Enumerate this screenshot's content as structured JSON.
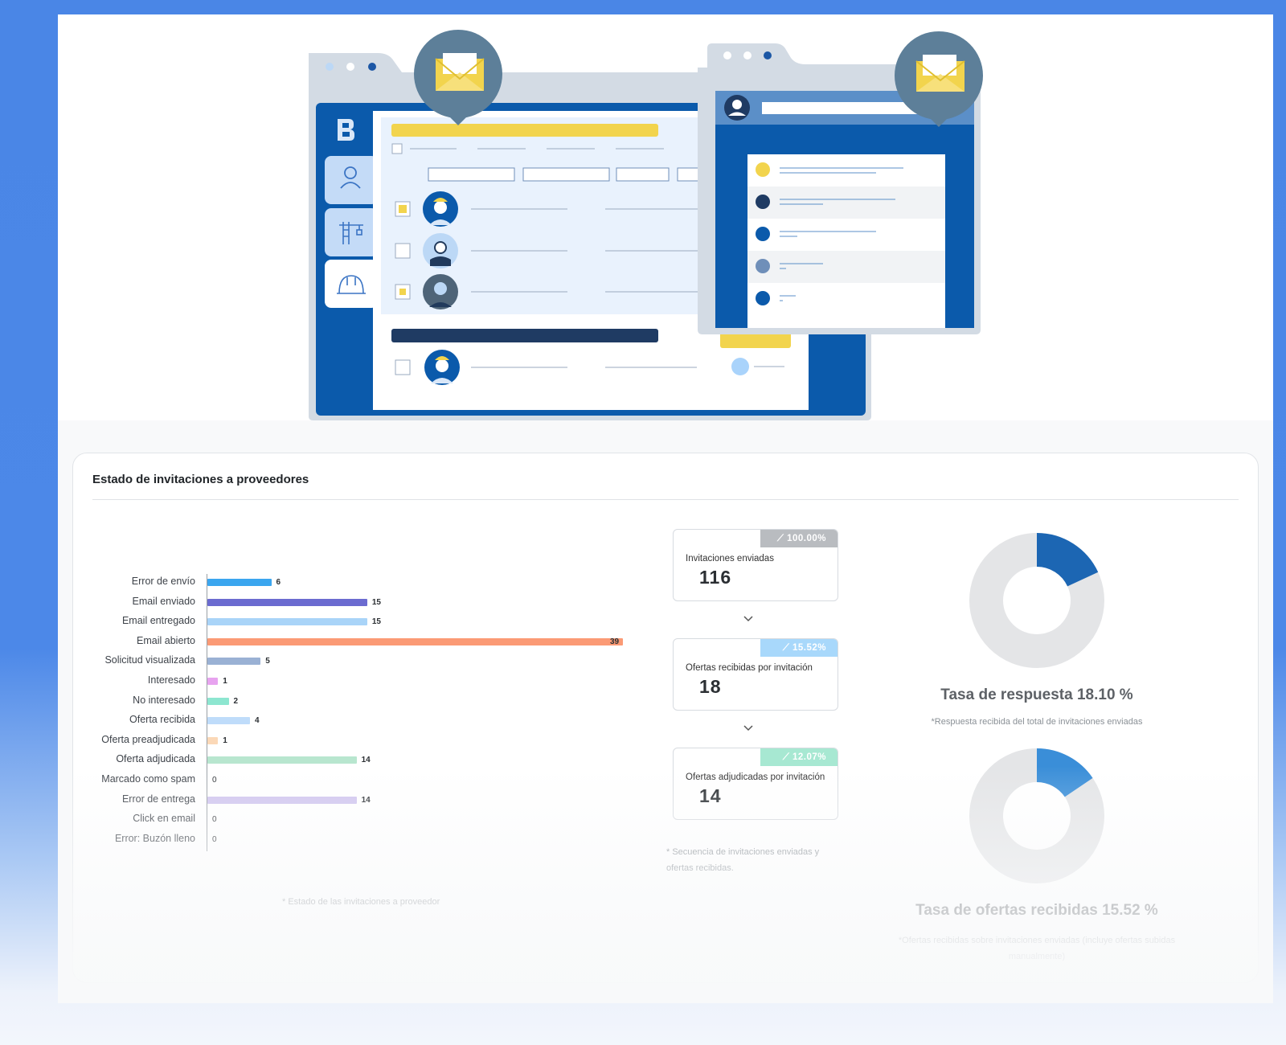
{
  "panel": {
    "title": "Estado de invitaciones a proveedores",
    "bar_note": "* Estado de las invitaciones a proveedor",
    "sequence_note_line1": "* Secuencia de invitaciones enviadas y",
    "sequence_note_line2": "ofertas recibidas."
  },
  "chart_data": {
    "type": "bar",
    "orientation": "horizontal",
    "categories": [
      "Error de envío",
      "Email enviado",
      "Email entregado",
      "Email abierto",
      "Solicitud visualizada",
      "Interesado",
      "No interesado",
      "Oferta recibida",
      "Oferta preadjudicada",
      "Oferta adjudicada",
      "Marcado como spam",
      "Error de entrega",
      "Click en email",
      "Error: Buzón lleno"
    ],
    "values": [
      6,
      15,
      15,
      39,
      5,
      1,
      2,
      4,
      1,
      14,
      0,
      14,
      0,
      0
    ],
    "colors": [
      "#3ba6ef",
      "#6b6bd0",
      "#a9d4f8",
      "#fb9a75",
      "#9ab1d4",
      "#e7a3ef",
      "#8de6d0",
      "#bfdcfa",
      "#fbd8b7",
      "#b8e6cf",
      "#cfcfcf",
      "#d1c6ef",
      "#cfcfcf",
      "#cfcfcf"
    ],
    "xlim": [
      0,
      39
    ]
  },
  "kpis": [
    {
      "label": "Invitaciones enviadas",
      "value": "116",
      "badge": "100.00%",
      "badge_color": "#b9bcc0"
    },
    {
      "label": "Ofertas recibidas por invitación",
      "value": "18",
      "badge": "15.52%",
      "badge_color": "#a8d8fb"
    },
    {
      "label": "Ofertas adjudicadas por invitación",
      "value": "14",
      "badge": "12.07%",
      "badge_color": "#a7e8d2"
    }
  ],
  "donuts": [
    {
      "title": "Tasa de respuesta 18.10 %",
      "note": "*Respuesta recibida del total de invitaciones enviadas",
      "fraction": 0.181,
      "color": "#1c66b3"
    },
    {
      "title": "Tasa de ofertas recibidas 15.52 %",
      "note_line1": "*Ofertas recibidas sobre invitaciones enviadas (incluye ofertas subidas",
      "note_line2": "manualmente)",
      "fraction": 0.1552,
      "color": "#3a8ed8"
    }
  ]
}
